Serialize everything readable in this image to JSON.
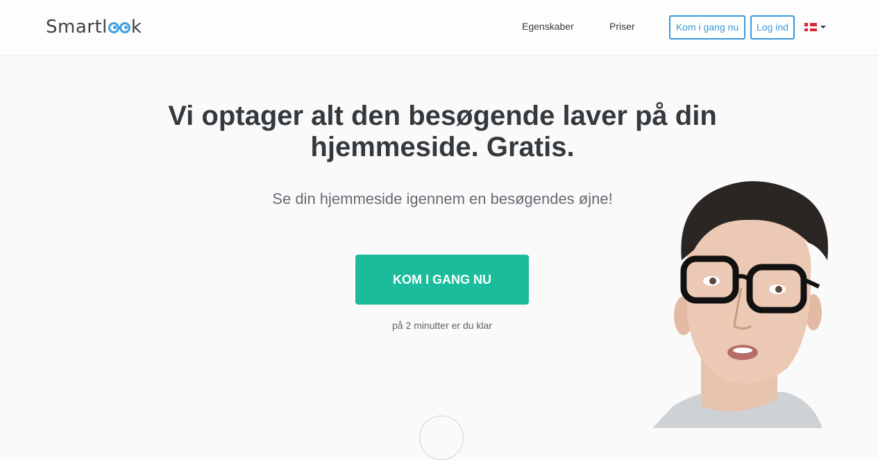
{
  "header": {
    "logo": {
      "prefix": "Smartl",
      "suffix": "k"
    },
    "nav": {
      "features": "Egenskaber",
      "prices": "Priser"
    },
    "start_button": "Kom i gang nu",
    "login_button": "Log ind",
    "language": {
      "flag": "danish-flag-icon",
      "selected": "da"
    }
  },
  "hero": {
    "headline": "Vi optager alt den besøgende laver på din hjemmeside. Gratis.",
    "subheadline": "Se din hjemmeside igennem en besøgendes øjne!",
    "cta_label": "KOM I GANG NU",
    "cta_note": "på 2 minutter er du klar"
  },
  "colors": {
    "accent": "#1abc9c",
    "link_blue": "#3a98d6",
    "text": "#34393e",
    "background": "#fafafa"
  }
}
